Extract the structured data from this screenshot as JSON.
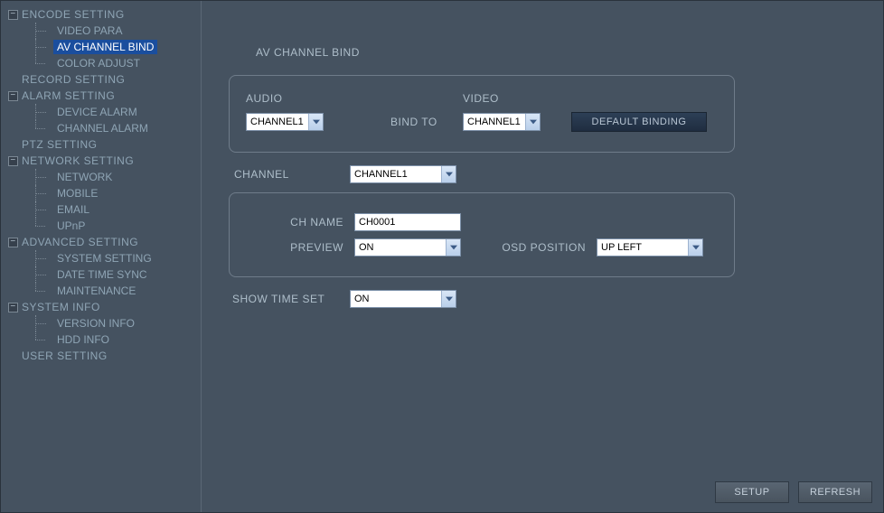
{
  "sidebar": {
    "groups": [
      {
        "label": "ENCODE SETTING",
        "expandable": true,
        "children": [
          {
            "label": "VIDEO PARA",
            "active": false
          },
          {
            "label": "AV CHANNEL BIND",
            "active": true
          },
          {
            "label": "COLOR ADJUST",
            "active": false
          }
        ]
      },
      {
        "label": "RECORD SETTING",
        "expandable": false,
        "children": []
      },
      {
        "label": "ALARM SETTING",
        "expandable": true,
        "children": [
          {
            "label": "DEVICE ALARM",
            "active": false
          },
          {
            "label": "CHANNEL ALARM",
            "active": false
          }
        ]
      },
      {
        "label": "PTZ SETTING",
        "expandable": false,
        "children": []
      },
      {
        "label": "NETWORK SETTING",
        "expandable": true,
        "children": [
          {
            "label": "NETWORK",
            "active": false
          },
          {
            "label": "MOBILE",
            "active": false
          },
          {
            "label": "EMAIL",
            "active": false
          },
          {
            "label": "UPnP",
            "active": false
          }
        ]
      },
      {
        "label": "ADVANCED SETTING",
        "expandable": true,
        "children": [
          {
            "label": "SYSTEM SETTING",
            "active": false
          },
          {
            "label": "DATE TIME SYNC",
            "active": false
          },
          {
            "label": "MAINTENANCE",
            "active": false
          }
        ]
      },
      {
        "label": "SYSTEM INFO",
        "expandable": true,
        "children": [
          {
            "label": "VERSION INFO",
            "active": false
          },
          {
            "label": "HDD INFO",
            "active": false
          }
        ]
      },
      {
        "label": "USER SETTING",
        "expandable": false,
        "children": []
      }
    ]
  },
  "page": {
    "title": "AV CHANNEL BIND",
    "bind_panel": {
      "audio_label": "AUDIO",
      "audio_value": "CHANNEL1",
      "bind_to_label": "BIND TO",
      "video_label": "VIDEO",
      "video_value": "CHANNEL1",
      "default_button": "DEFAULT BINDING"
    },
    "channel_label": "CHANNEL",
    "channel_value": "CHANNEL1",
    "channel_panel": {
      "ch_name_label": "CH NAME",
      "ch_name_value": "CH0001",
      "preview_label": "PREVIEW",
      "preview_value": "ON",
      "osd_label": "OSD POSITION",
      "osd_value": "UP LEFT"
    },
    "show_time_label": "SHOW TIME SET",
    "show_time_value": "ON"
  },
  "footer": {
    "setup": "SETUP",
    "refresh": "REFRESH"
  },
  "icons": {
    "minus": "−"
  }
}
